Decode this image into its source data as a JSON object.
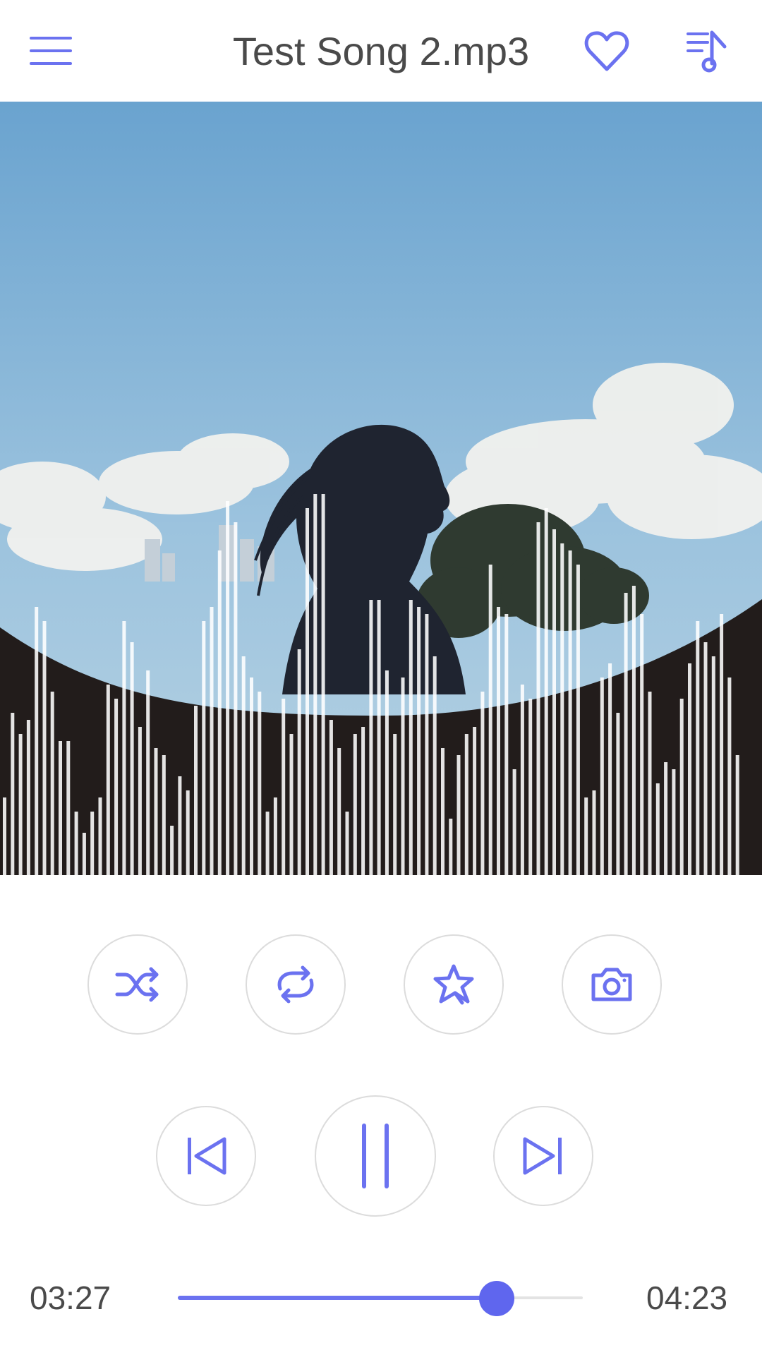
{
  "header": {
    "title": "Test Song 2.mp3",
    "icons": [
      "menu-icon",
      "heart-icon",
      "playlist-music-icon"
    ]
  },
  "artwork": {
    "description_icon": "album-art-image"
  },
  "controls": {
    "row1": [
      "shuffle-icon",
      "repeat-icon",
      "star-effects-icon",
      "camera-icon"
    ],
    "row2": [
      "skip-previous-icon",
      "pause-icon",
      "skip-next-icon"
    ]
  },
  "progress": {
    "current_time": "03:27",
    "total_time": "04:23",
    "fraction": 0.787
  },
  "colors": {
    "accent": "#6b72f0",
    "text": "#4a4a4a",
    "circle_border": "#dcdcdc"
  }
}
